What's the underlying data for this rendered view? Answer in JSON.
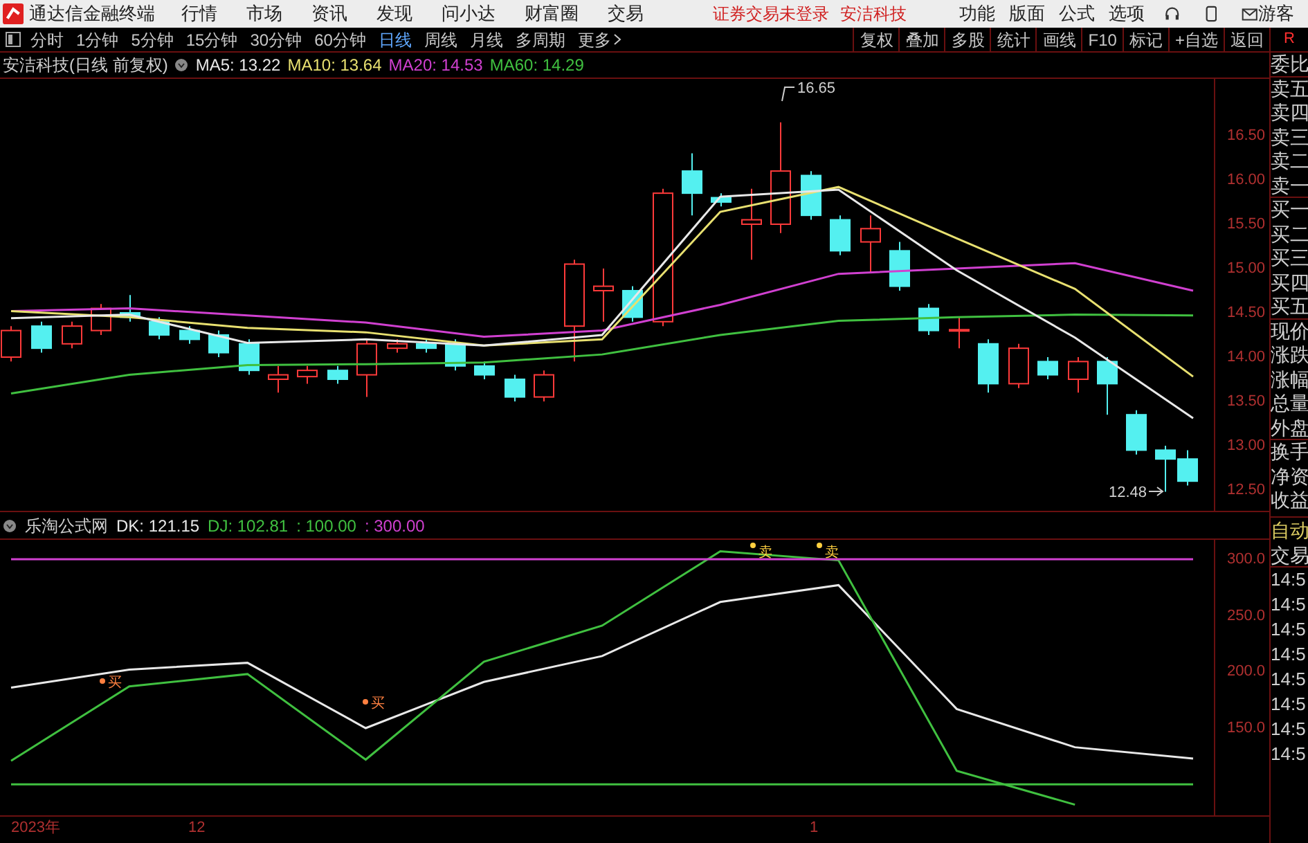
{
  "app_bar": {
    "title": "通达信金融终端",
    "menu": [
      "行情",
      "市场",
      "资讯",
      "发现",
      "问小达",
      "财富圈",
      "交易"
    ],
    "status": "证券交易未登录",
    "stock": "安洁科技",
    "right_menu": [
      "功能",
      "版面",
      "公式",
      "选项"
    ],
    "user": "游客"
  },
  "toolbar": {
    "periods": [
      {
        "label": "分时",
        "selected": false
      },
      {
        "label": "1分钟",
        "selected": false
      },
      {
        "label": "5分钟",
        "selected": false
      },
      {
        "label": "15分钟",
        "selected": false
      },
      {
        "label": "30分钟",
        "selected": false
      },
      {
        "label": "60分钟",
        "selected": false
      },
      {
        "label": "日线",
        "selected": true
      },
      {
        "label": "周线",
        "selected": false
      },
      {
        "label": "月线",
        "selected": false
      },
      {
        "label": "多周期",
        "selected": false
      }
    ],
    "more": "更多",
    "buttons": [
      "复权",
      "叠加",
      "多股",
      "统计",
      "画线",
      "F10",
      "标记",
      "+自选",
      "返回"
    ],
    "corner": "R"
  },
  "main_chart": {
    "title": "安洁科技(日线 前复权)",
    "ma": [
      ": 13.22",
      ": 13.64",
      ": 14.53",
      ": 14.29"
    ],
    "high_mark": "16.65",
    "low_mark": "12.48",
    "chart_data": {
      "type": "line",
      "ylim": [
        12.25,
        17.14
      ],
      "yticks": [
        {
          "value": 16.5,
          "label": "16.50"
        },
        {
          "value": 16,
          "label": "16.00"
        },
        {
          "value": 15.5,
          "label": "15.50"
        },
        {
          "value": 15,
          "label": "15.00"
        },
        {
          "value": 14.5,
          "label": "14.50"
        },
        {
          "value": 14,
          "label": "14.00"
        },
        {
          "value": 13.5,
          "label": "13.50"
        },
        {
          "value": 13,
          "label": "13.00"
        },
        {
          "value": 12.5,
          "label": "12.50"
        }
      ],
      "series": [
        {
          "name": "MA5",
          "color": "#e8e8e8",
          "values": [
            14.44,
            14.48,
            14.16,
            14.2,
            14.13,
            14.25,
            15.81,
            15.89,
            14.98,
            14.22,
            13.31
          ]
        },
        {
          "name": "MA10",
          "color": "#e8e070",
          "values": [
            14.52,
            14.45,
            14.33,
            14.28,
            14.13,
            14.2,
            15.64,
            15.92,
            15.34,
            14.77,
            13.78
          ]
        },
        {
          "name": "MA20",
          "color": "#d040d0",
          "values": [
            14.52,
            14.55,
            14.47,
            14.39,
            14.23,
            14.3,
            14.59,
            14.94,
            15.0,
            15.06,
            14.75
          ]
        },
        {
          "name": "MA60",
          "color": "#40c040",
          "values": [
            13.59,
            13.8,
            13.91,
            13.92,
            13.94,
            14.03,
            14.25,
            14.41,
            14.45,
            14.48,
            14.47
          ]
        }
      ]
    }
  },
  "indicator": {
    "title": "乐淘公式网",
    "values": [
      ": 121.15",
      ": 102.81",
      ": 100.00",
      ": 300.00"
    ],
    "signals": [
      {
        "label": "买",
        "kind": "buy"
      },
      {
        "label": "买",
        "kind": "buy"
      },
      {
        "label": "卖",
        "kind": "sell"
      },
      {
        "label": "卖",
        "kind": "sell"
      }
    ],
    "chart_data": {
      "type": "line",
      "ylim": [
        71.3,
        317.2
      ],
      "yticks": [
        {
          "value": 300,
          "label": "300.0"
        },
        {
          "value": 250,
          "label": "250.0"
        },
        {
          "value": 200,
          "label": "200.0"
        },
        {
          "value": 150,
          "label": "150.0"
        }
      ],
      "series": [
        {
          "name": "DK",
          "color": "#e8e8e8",
          "values": [
            186,
            202,
            208,
            150,
            191,
            214,
            262,
            277,
            167,
            133,
            123
          ]
        },
        {
          "name": "DJ",
          "color": "#40c040",
          "values": [
            121,
            187,
            198,
            122,
            209,
            241,
            307,
            299,
            112,
            82,
            null
          ]
        },
        {
          "color": "#40c040",
          "values": [
            100,
            100,
            100,
            100,
            100,
            100,
            100,
            100,
            100,
            100,
            100
          ]
        },
        {
          "color": "#d040d0",
          "values": [
            300,
            300,
            300,
            300,
            300,
            300,
            300,
            300,
            300,
            300,
            300
          ]
        }
      ]
    }
  },
  "side_panel": {
    "quote_labels": [
      "委比",
      "卖五",
      "卖四",
      "卖三",
      "卖二",
      "卖一",
      "买一",
      "买二",
      "买三",
      "买四",
      "买五",
      "现价",
      "涨跌",
      "涨幅",
      "总量",
      "外盘",
      "换手",
      "净资",
      "收益"
    ],
    "trade_tabs": [
      "自动",
      "交易"
    ],
    "times": [
      "14:5",
      "14:5",
      "14:5",
      "14:5",
      "14:5",
      "14:5",
      "14:5",
      "14:5"
    ]
  },
  "time_axis": [
    "2023年",
    "12",
    "1"
  ]
}
